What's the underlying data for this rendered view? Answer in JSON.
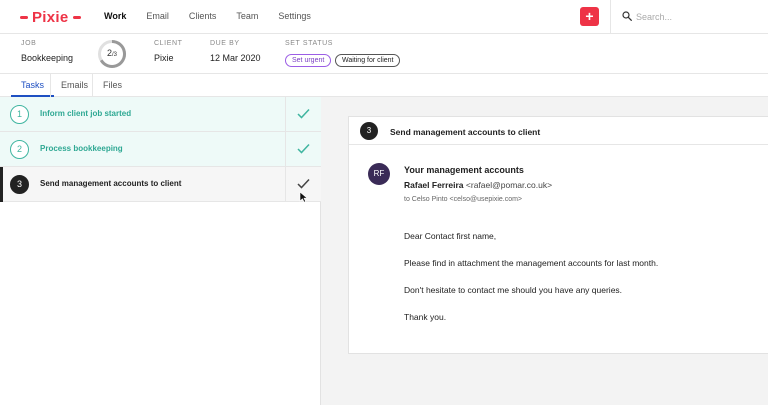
{
  "app": {
    "logo": "Pixie"
  },
  "nav": {
    "items": [
      "Work",
      "Email",
      "Clients",
      "Team",
      "Settings"
    ],
    "active": "Work"
  },
  "search": {
    "placeholder": "Search..."
  },
  "add_button": {
    "label": "+"
  },
  "job": {
    "job_label": "JOB",
    "job_value": "Bookkeeping",
    "progress_done": "2",
    "progress_total": "3",
    "client_label": "CLIENT",
    "client_value": "Pixie",
    "due_label": "DUE BY",
    "due_value": "12 Mar 2020",
    "status_label": "SET STATUS",
    "tag_urgent": "Set urgent",
    "tag_waiting": "Waiting for client"
  },
  "tabs": [
    "Tasks",
    "Emails",
    "Files"
  ],
  "tasks": [
    {
      "num": "1",
      "title": "Inform client job started",
      "status": "done"
    },
    {
      "num": "2",
      "title": "Process bookkeeping",
      "status": "done"
    },
    {
      "num": "3",
      "title": "Send management accounts to client",
      "status": "current"
    }
  ],
  "detail": {
    "num": "3",
    "title": "Send management accounts to client",
    "avatar": "RF",
    "subject": "Your management accounts",
    "from_name": "Rafael Ferreira",
    "from_email": "<rafael@pomar.co.uk>",
    "to_prefix": "to Celso Pinto",
    "to_email": "<celso@usepixie.com>",
    "body": [
      "Dear Contact first name,",
      "Please find in attachment the management accounts for last month.",
      "Don't hesitate to contact me should you have any queries.",
      "Thank you."
    ]
  },
  "colors": {
    "brand": "#ee3346",
    "done": "#3fb5a0",
    "tab_active": "#1e4fc2",
    "avatar": "#3a2b57"
  }
}
